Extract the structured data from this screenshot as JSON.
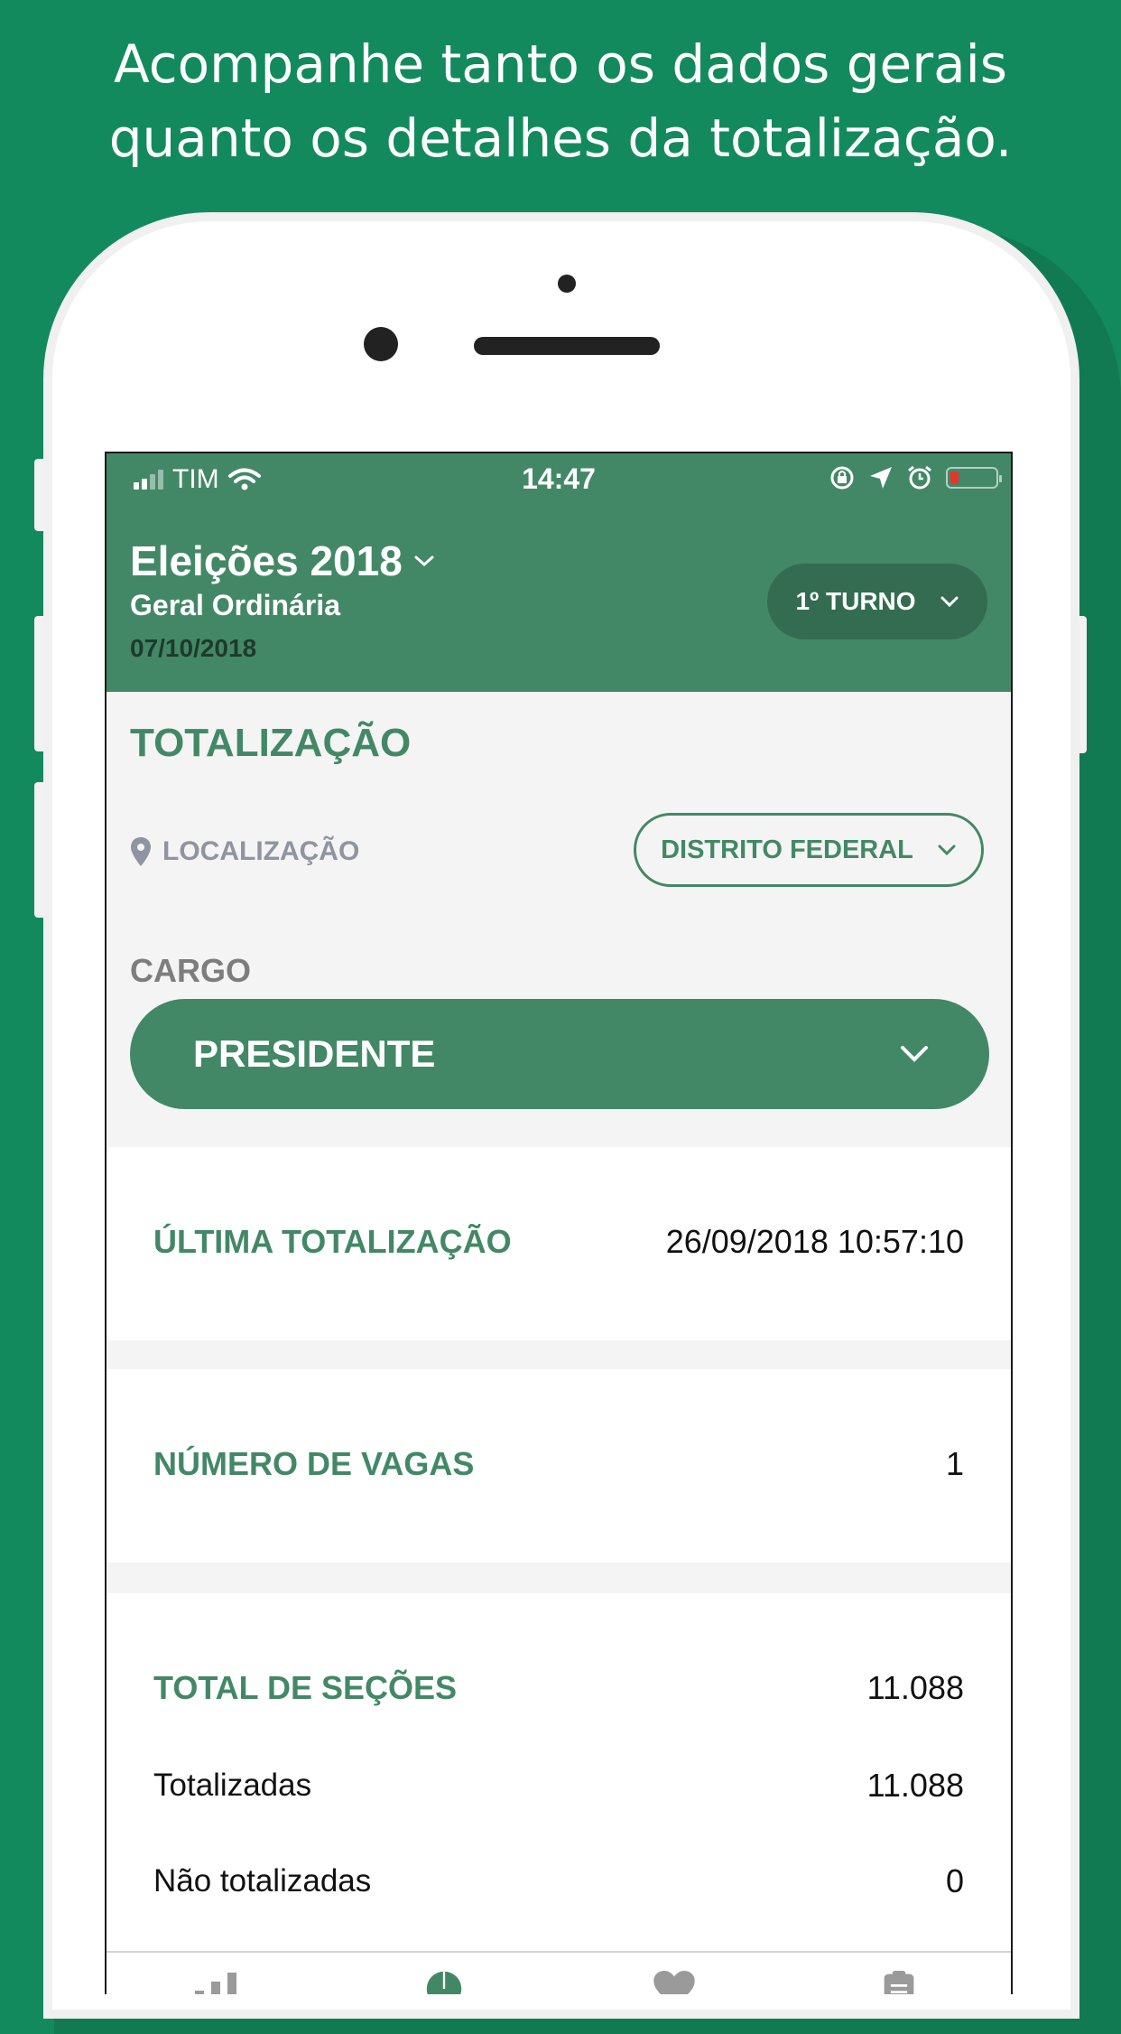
{
  "promo": {
    "line1": "Acompanhe tanto os dados gerais",
    "line2": "quanto os detalhes da totalização."
  },
  "status_bar": {
    "carrier": "TIM",
    "time": "14:47"
  },
  "header": {
    "title": "Eleições 2018",
    "subtitle": "Geral Ordinária",
    "date": "07/10/2018",
    "turno_label": "1º TURNO"
  },
  "filters": {
    "section_title": "TOTALIZAÇÃO",
    "location_label": "LOCALIZAÇÃO",
    "location_value": "DISTRITO FEDERAL",
    "cargo_label": "CARGO",
    "cargo_value": "PRESIDENTE"
  },
  "summary": {
    "last_total_label": "ÚLTIMA TOTALIZAÇÃO",
    "last_total_value": "26/09/2018 10:57:10",
    "vagas_label": "NÚMERO DE VAGAS",
    "vagas_value": "1",
    "secoes_label": "TOTAL DE SEÇÕES",
    "secoes_value": "11.088",
    "totalizadas_label": "Totalizadas",
    "totalizadas_value": "11.088",
    "nao_totalizadas_label": "Não totalizadas",
    "nao_totalizadas_value": "0"
  },
  "colors": {
    "background": "#138a5e",
    "app_green": "#438866",
    "dark_green": "#336c50"
  },
  "tabbar": {
    "icons": [
      "bar-chart-icon",
      "pie-chart-icon",
      "heart-icon",
      "clipboard-icon"
    ]
  }
}
